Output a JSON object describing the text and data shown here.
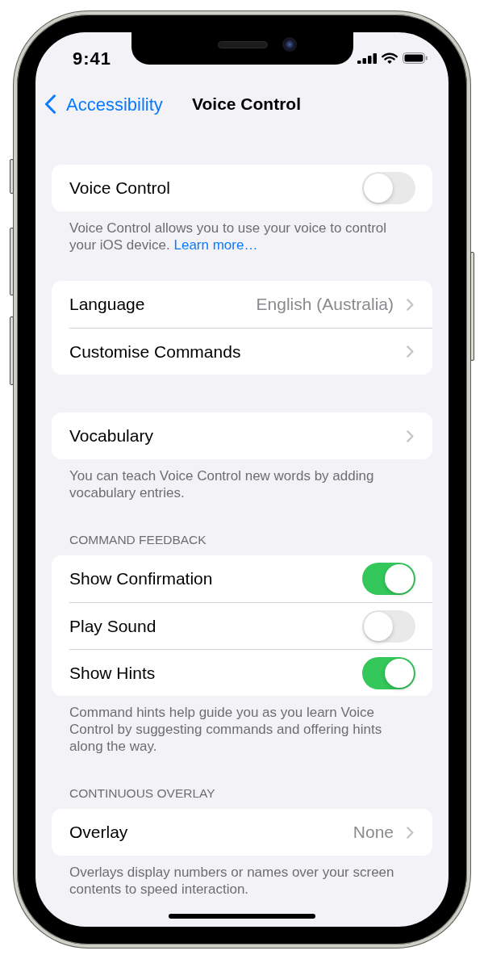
{
  "status_bar": {
    "time": "9:41"
  },
  "nav_bar": {
    "back": "Accessibility",
    "title": "Voice Control"
  },
  "sections": [
    {
      "rows": [
        {
          "kind": "toggle",
          "label": "Voice Control",
          "on": false
        }
      ],
      "footer": {
        "text": "Voice Control allows you to use your voice to control your iOS device.",
        "link": "Learn more…"
      }
    },
    {
      "rows": [
        {
          "kind": "link",
          "label": "Language",
          "value": "English (Australia)"
        },
        {
          "kind": "link",
          "label": "Customise Commands"
        }
      ]
    },
    {
      "rows": [
        {
          "kind": "link",
          "label": "Vocabulary"
        }
      ],
      "footer": {
        "text": "You can teach Voice Control new words by adding vocabulary entries."
      }
    },
    {
      "header": "COMMAND FEEDBACK",
      "rows": [
        {
          "kind": "toggle",
          "label": "Show Confirmation",
          "on": true
        },
        {
          "kind": "toggle",
          "label": "Play Sound",
          "on": false
        },
        {
          "kind": "toggle",
          "label": "Show Hints",
          "on": true
        }
      ],
      "footer": {
        "text": "Command hints help guide you as you learn Voice Control by suggesting commands and offering hints along the way."
      }
    },
    {
      "header": "CONTINUOUS OVERLAY",
      "rows": [
        {
          "kind": "link",
          "label": "Overlay",
          "value": "None"
        }
      ],
      "footer": {
        "text": "Overlays display numbers or names over your screen contents to speed interaction."
      }
    }
  ]
}
